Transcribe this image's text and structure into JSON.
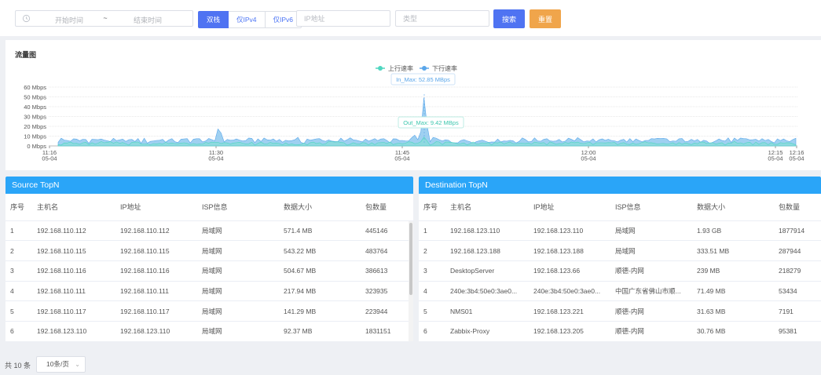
{
  "filter": {
    "start_placeholder": "开始时间",
    "range_separator": "~",
    "end_placeholder": "结束时间",
    "stack_options": [
      "双栈",
      "仅IPv4",
      "仅IPv6"
    ],
    "stack_selected": "双栈",
    "ip_placeholder": "IP地址",
    "type_placeholder": "类型",
    "search_label": "搜索",
    "reset_label": "重置"
  },
  "chart": {
    "title": "流量图",
    "legend": [
      {
        "name": "上行速率",
        "color": "#4fd6c0"
      },
      {
        "name": "下行速率",
        "color": "#5aa6ea"
      }
    ],
    "tooltip_in": "In_Max: 52.85 MBps",
    "tooltip_out": "Out_Max: 9.42 MBps"
  },
  "chart_data": {
    "type": "area",
    "title": "流量图",
    "y_ticks": [
      "0 Mbps",
      "10 Mbps",
      "20 Mbps",
      "30 Mbps",
      "40 Mbps",
      "50 Mbps",
      "60 Mbps"
    ],
    "ylim": [
      0,
      60
    ],
    "x_ticks": [
      {
        "time": "11:16",
        "date": "05-04"
      },
      {
        "time": "11:30",
        "date": "05-04"
      },
      {
        "time": "11:45",
        "date": "05-04"
      },
      {
        "time": "12:00",
        "date": "05-04"
      },
      {
        "time": "12:15",
        "date": "05-04"
      },
      {
        "time": "12:16",
        "date": "05-04"
      }
    ],
    "series": [
      {
        "name": "下行速率",
        "color": "#5aa6ea",
        "peak": 52.85
      },
      {
        "name": "上行速率",
        "color": "#4fd6c0",
        "peak": 9.42
      }
    ],
    "legend_position": "top-center",
    "grid": true
  },
  "source": {
    "title": "Source TopN",
    "columns": [
      "序号",
      "主机名",
      "IP地址",
      "ISP信息",
      "数据大小",
      "包数量"
    ],
    "rows": [
      [
        "1",
        "192.168.110.112",
        "192.168.110.112",
        "局域网",
        "571.4 MB",
        "445146"
      ],
      [
        "2",
        "192.168.110.115",
        "192.168.110.115",
        "局域网",
        "543.22 MB",
        "483764"
      ],
      [
        "3",
        "192.168.110.116",
        "192.168.110.116",
        "局域网",
        "504.67 MB",
        "386613"
      ],
      [
        "4",
        "192.168.110.111",
        "192.168.110.111",
        "局域网",
        "217.94 MB",
        "323935"
      ],
      [
        "5",
        "192.168.110.117",
        "192.168.110.117",
        "局域网",
        "141.29 MB",
        "223944"
      ],
      [
        "6",
        "192.168.123.110",
        "192.168.123.110",
        "局域网",
        "92.37 MB",
        "1831151"
      ]
    ]
  },
  "destination": {
    "title": "Destination TopN",
    "columns": [
      "序号",
      "主机名",
      "IP地址",
      "ISP信息",
      "数据大小",
      "包数量"
    ],
    "rows": [
      [
        "1",
        "192.168.123.110",
        "192.168.123.110",
        "局域网",
        "1.93 GB",
        "1877914"
      ],
      [
        "2",
        "192.168.123.188",
        "192.168.123.188",
        "局域网",
        "333.51 MB",
        "287944"
      ],
      [
        "3",
        "DesktopServer",
        "192.168.123.66",
        "顺德-内网",
        "239 MB",
        "218279"
      ],
      [
        "4",
        "240e:3b4:50e0:3ae0...",
        "240e:3b4:50e0:3ae0...",
        "中国广东省佛山市顺...",
        "71.49 MB",
        "53434"
      ],
      [
        "5",
        "NMS01",
        "192.168.123.221",
        "顺德-内网",
        "31.63 MB",
        "7191"
      ],
      [
        "6",
        "Zabbix-Proxy",
        "192.168.123.205",
        "顺德-内网",
        "30.76 MB",
        "95381"
      ]
    ]
  },
  "pagination": {
    "total_label": "共 10 条",
    "page_size_label": "10条/页"
  }
}
